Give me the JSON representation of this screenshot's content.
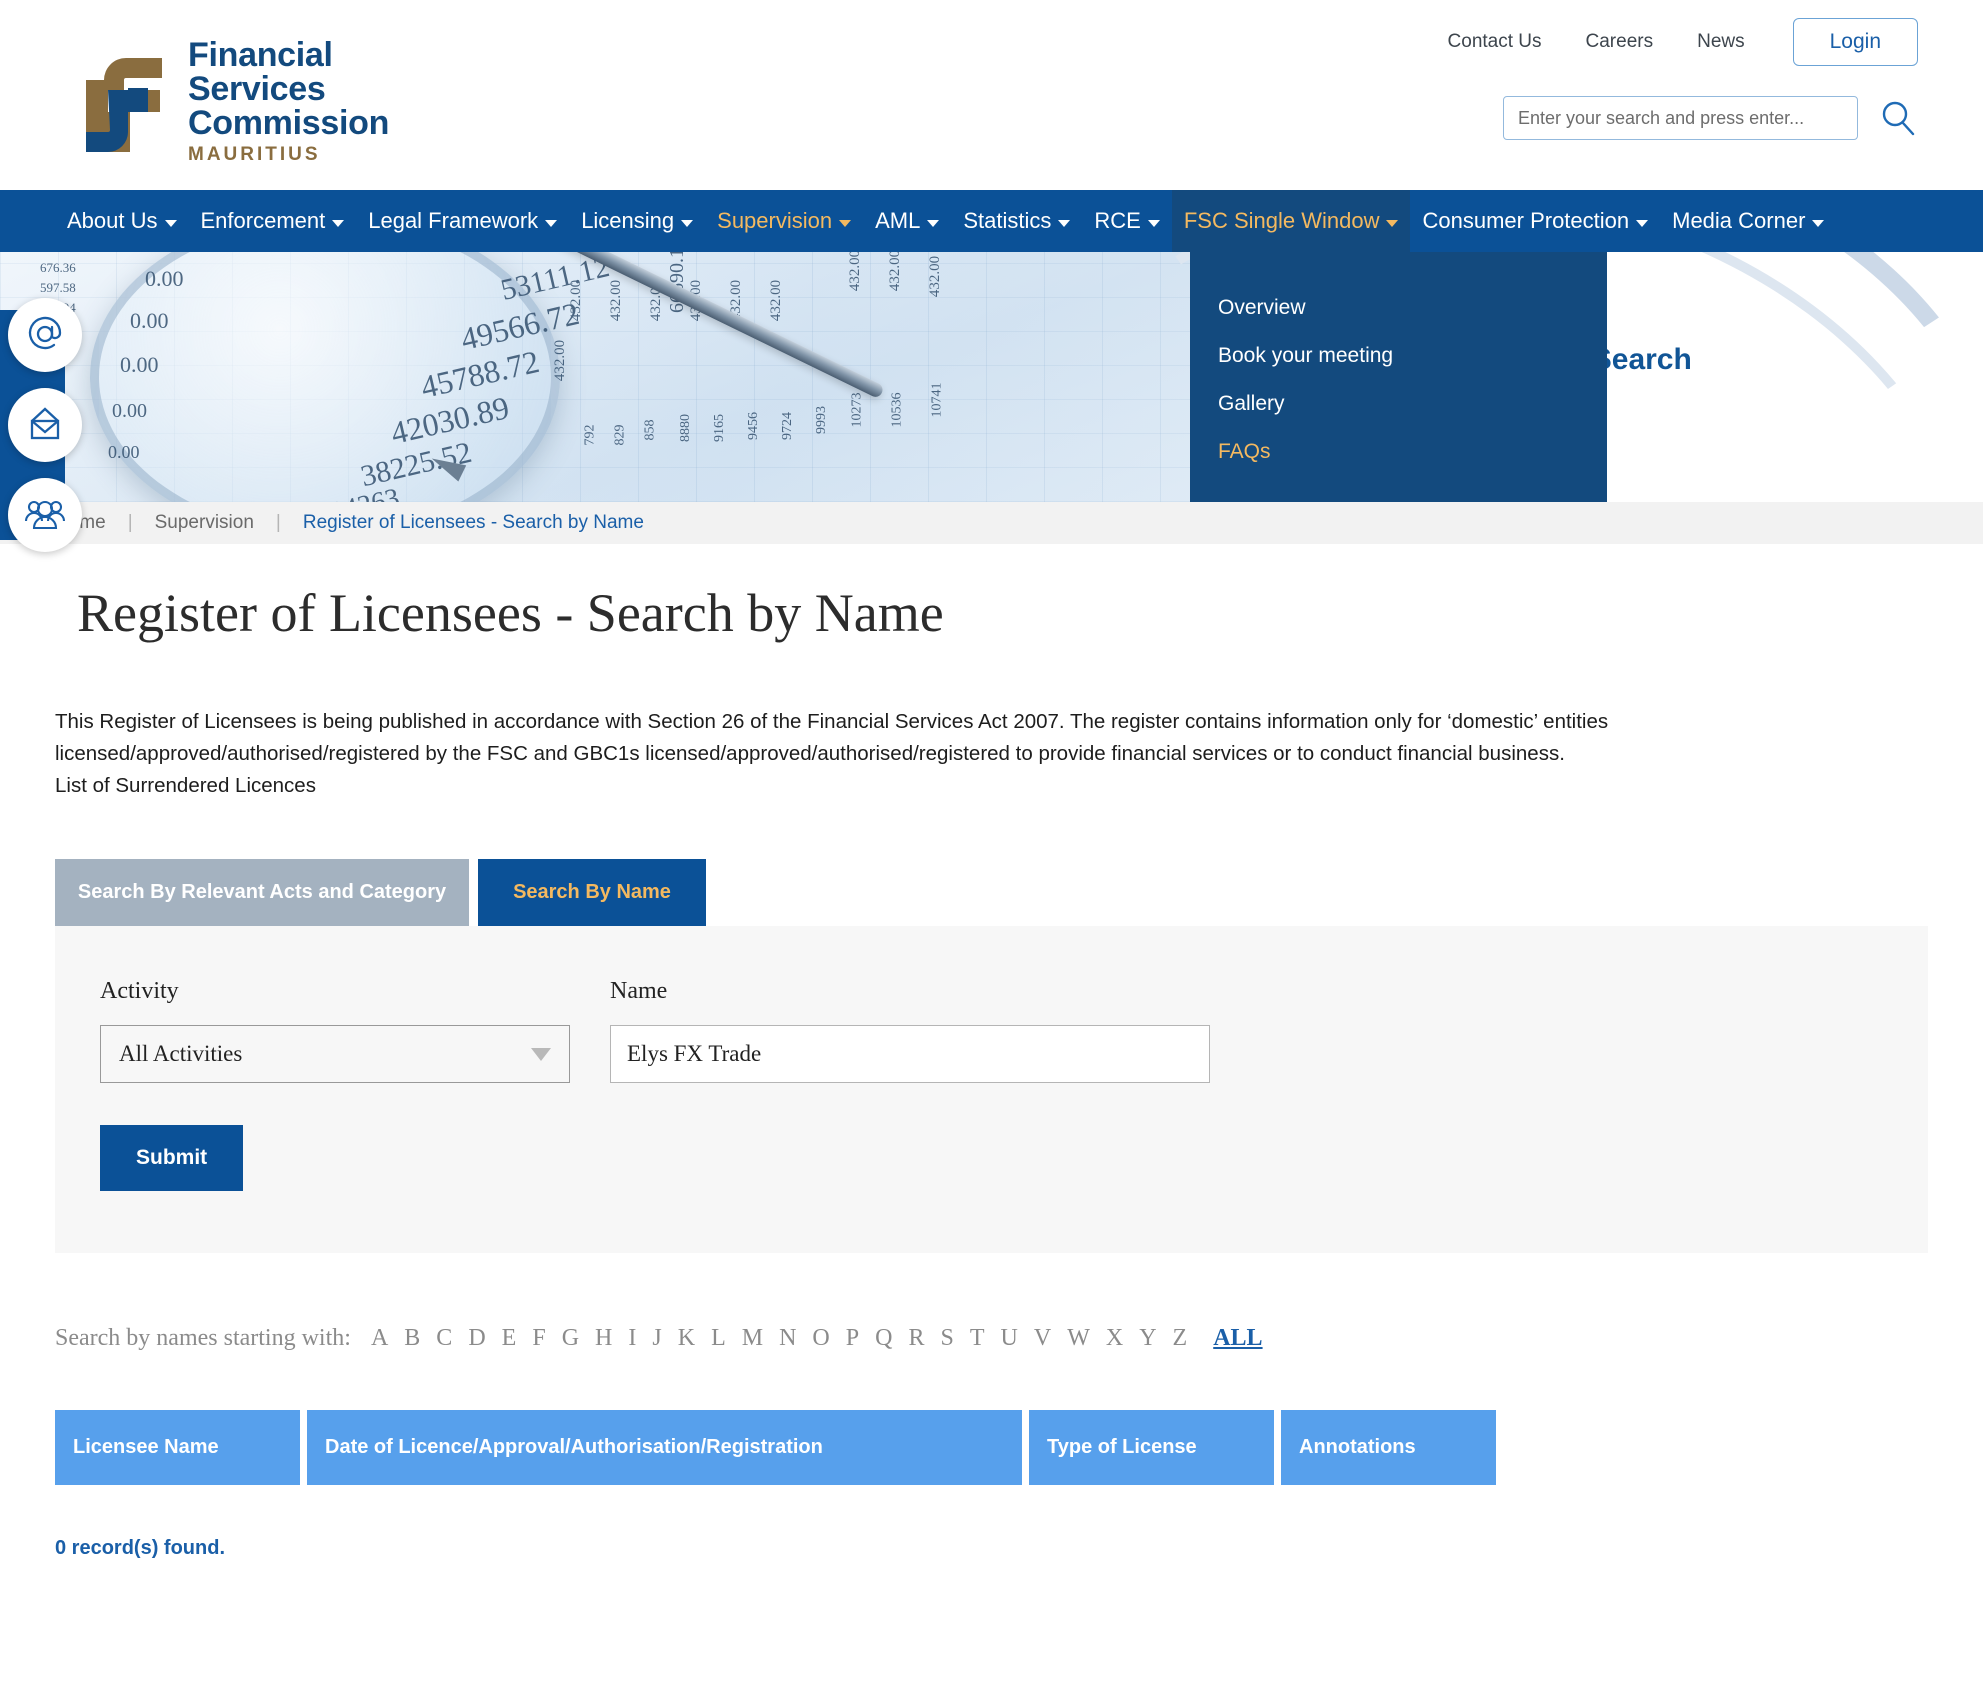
{
  "header": {
    "logo": {
      "line1": "Financial",
      "line2": "Services",
      "line3": "Commission",
      "line4": "MAURITIUS"
    },
    "util_links": [
      "Contact Us",
      "Careers",
      "News"
    ],
    "login_label": "Login",
    "search_placeholder": "Enter your search and press enter...",
    "search_value": ""
  },
  "nav": {
    "items": [
      {
        "label": "About Us",
        "state": "normal"
      },
      {
        "label": "Enforcement",
        "state": "normal"
      },
      {
        "label": "Legal Framework",
        "state": "normal"
      },
      {
        "label": "Licensing",
        "state": "normal"
      },
      {
        "label": "Supervision",
        "state": "highlight"
      },
      {
        "label": "AML",
        "state": "normal"
      },
      {
        "label": "Statistics",
        "state": "normal"
      },
      {
        "label": "RCE",
        "state": "normal"
      },
      {
        "label": "FSC Single Window",
        "state": "open"
      },
      {
        "label": "Consumer Protection",
        "state": "normal"
      },
      {
        "label": "Media Corner",
        "state": "normal"
      }
    ]
  },
  "dropdown": {
    "items": [
      {
        "label": "Overview",
        "highlight": false
      },
      {
        "label": "Book your meeting",
        "highlight": false
      },
      {
        "label": "Gallery",
        "highlight": false
      },
      {
        "label": "FAQs",
        "highlight": true
      }
    ]
  },
  "hero": {
    "title": "Register of Licensees - Search by Name"
  },
  "rail": {
    "icons": [
      "at-sign-icon",
      "envelope-icon",
      "people-icon"
    ]
  },
  "breadcrumb": {
    "home": "Home",
    "section": "Supervision",
    "current": "Register of Licensees - Search by Name",
    "separator": "|"
  },
  "page": {
    "title": "Register of Licensees - Search by Name",
    "intro_line1": "This Register of Licensees is being published in accordance with Section 26 of the Financial Services Act 2007. The register contains information only for ‘domestic’ entities",
    "intro_line2": "licensed/approved/authorised/registered by the FSC and GBC1s licensed/approved/authorised/registered to provide financial services or to conduct financial business.",
    "intro_line3": "List of Surrendered Licences"
  },
  "tabs": {
    "inactive_label": "Search By Relevant Acts and Category",
    "active_label": "Search By Name"
  },
  "form": {
    "activity_label": "Activity",
    "activity_value": "All Activities",
    "name_label": "Name",
    "name_value": "Elys FX Trade",
    "name_placeholder": "",
    "submit_label": "Submit"
  },
  "alpha": {
    "label": "Search by names starting with:",
    "letters": [
      "A",
      "B",
      "C",
      "D",
      "E",
      "F",
      "G",
      "H",
      "I",
      "J",
      "K",
      "L",
      "M",
      "N",
      "O",
      "P",
      "Q",
      "R",
      "S",
      "T",
      "U",
      "V",
      "W",
      "X",
      "Y",
      "Z"
    ],
    "all_label": "ALL"
  },
  "table": {
    "columns": [
      "Licensee Name",
      "Date of Licence/Approval/Authorisation/Registration",
      "Type of License",
      "Annotations"
    ],
    "rows": [],
    "records_found": "0 record(s) found."
  },
  "colors": {
    "nav_blue": "#0b5197",
    "dark_blue": "#134a7e",
    "gold": "#f4b960",
    "table_header_blue": "#57a0ec",
    "link_blue": "#1a5fa8",
    "logo_brown": "#8a6d3f"
  }
}
